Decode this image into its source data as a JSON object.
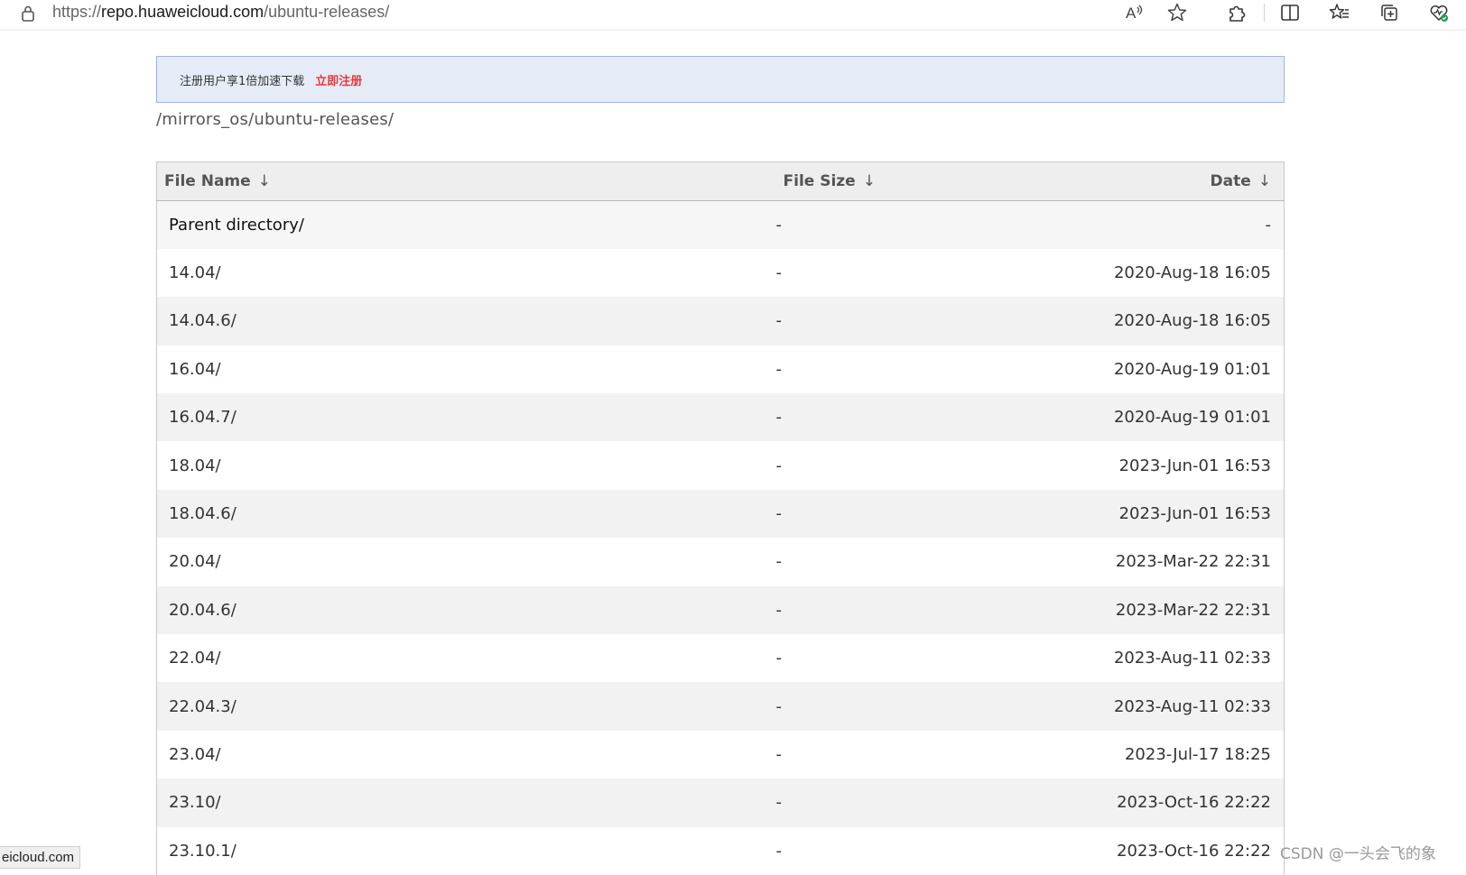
{
  "browser": {
    "url_prefix": "https://",
    "url_host": "repo.huaweicloud.com",
    "url_path": "/ubuntu-releases/",
    "icons": [
      "lock-icon",
      "read-aloud-icon",
      "favorite-star-icon",
      "extensions-icon",
      "split-screen-icon",
      "favorites-icon",
      "collections-icon",
      "browser-essentials-icon"
    ]
  },
  "promo": {
    "text": "注册用户享1倍加速下载",
    "link": "立即注册"
  },
  "breadcrumb": "/mirrors_os/ubuntu-releases/",
  "table": {
    "headers": {
      "name": "File Name",
      "size": "File Size",
      "date": "Date",
      "sort_arrow": "↓"
    },
    "rows": [
      {
        "name": "Parent directory/",
        "size": "-",
        "date": "-"
      },
      {
        "name": "14.04/",
        "size": "-",
        "date": "2020-Aug-18 16:05"
      },
      {
        "name": "14.04.6/",
        "size": "-",
        "date": "2020-Aug-18 16:05"
      },
      {
        "name": "16.04/",
        "size": "-",
        "date": "2020-Aug-19 01:01"
      },
      {
        "name": "16.04.7/",
        "size": "-",
        "date": "2020-Aug-19 01:01"
      },
      {
        "name": "18.04/",
        "size": "-",
        "date": "2023-Jun-01 16:53"
      },
      {
        "name": "18.04.6/",
        "size": "-",
        "date": "2023-Jun-01 16:53"
      },
      {
        "name": "20.04/",
        "size": "-",
        "date": "2023-Mar-22 22:31"
      },
      {
        "name": "20.04.6/",
        "size": "-",
        "date": "2023-Mar-22 22:31"
      },
      {
        "name": "22.04/",
        "size": "-",
        "date": "2023-Aug-11 02:33"
      },
      {
        "name": "22.04.3/",
        "size": "-",
        "date": "2023-Aug-11 02:33"
      },
      {
        "name": "23.04/",
        "size": "-",
        "date": "2023-Jul-17 18:25"
      },
      {
        "name": "23.10/",
        "size": "-",
        "date": "2023-Oct-16 22:22"
      },
      {
        "name": "23.10.1/",
        "size": "-",
        "date": "2023-Oct-16 22:22"
      }
    ]
  },
  "status_bar_url": "eicloud.com",
  "watermark": "CSDN @一头会飞的象",
  "colors": {
    "promo_bg": "#e6ecf7",
    "promo_border": "#9db4dc",
    "register_link": "#e63c3c",
    "header_bg": "#eeeeee",
    "row_alt_bg": "#f2f2f2"
  }
}
